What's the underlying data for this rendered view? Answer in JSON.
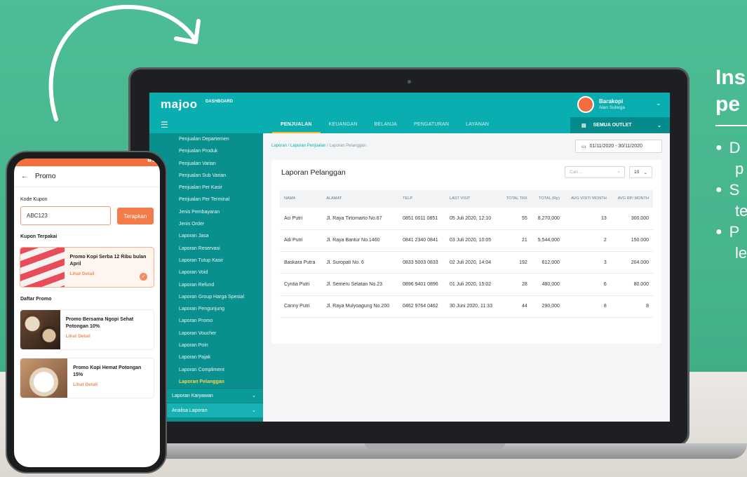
{
  "side": {
    "title_line1": "Ins",
    "title_line2": "pe",
    "bullets": [
      {
        "first": "D",
        "second": "p"
      },
      {
        "first": "S",
        "second": "te"
      },
      {
        "first": "P",
        "second": "le"
      }
    ]
  },
  "app": {
    "logo": "majoo",
    "logo_sub": "DASHBOARD",
    "user_name": "Barakopi",
    "user_sub": "Alan Suteqja"
  },
  "nav": {
    "tabs": [
      "PENJUALAN",
      "KEUANGAN",
      "BELANJA",
      "PENGATURAN",
      "LAYANAN"
    ],
    "active_tab": "PENJUALAN",
    "outlet": "SEMUA OUTLET"
  },
  "sidebar": {
    "items": [
      "Penjualan Departemen",
      "Penjualan Produk",
      "Penjualan Varian",
      "Penjualan Sub Varian",
      "Penjualan Per Kasir",
      "Penjualan Per Terminal",
      "Jenis Pembayaran",
      "Jenis Order",
      "Laporan Jasa",
      "Laporan Reservasi",
      "Laporan Tutup Kasir",
      "Laporan Void",
      "Laporan Refund",
      "Laporan Group Harga Spesial",
      "Laporan Pengunjung",
      "Laporan Promo",
      "Laporan Voucher",
      "Laporan Poin",
      "Laporan Pajak",
      "Laporan Compliment",
      "Laporan Pelanggan"
    ],
    "active_item": "Laporan Pelanggan",
    "section1": "Laporan Karyawan",
    "section2": "Analisa Laporan"
  },
  "breadcrumb": {
    "l1": "Laporan",
    "l2": "Laporan Penjualan",
    "l3": "Laporan Pelanggan"
  },
  "date_range": "01/11/2020  -  30/11/2020",
  "report": {
    "title": "Laporan Pelanggan",
    "search_placeholder": "Cari ...",
    "per_page": "10",
    "columns": [
      "NAMA",
      "ALAMAT",
      "TELP",
      "LAST VISIT",
      "TOTAL TRX",
      "TOTAL (Rp)",
      "AVG VISIT/ MONTH",
      "AVG RP/ MONTH"
    ],
    "rows": [
      [
        "Aci Putri",
        "Jl. Raya Tirtomarto No.67",
        "0851 0011 0851",
        "05 Juli 2020, 12:10",
        "55",
        "8,270,000",
        "13",
        "300.000"
      ],
      [
        "Adi Putri",
        "Jl. Raya Bantur No.1460",
        "0841 2340 0841",
        "03 Juli 2020, 10:05",
        "21",
        "5,544,000",
        "2",
        "150.000"
      ],
      [
        "Baskara Putra",
        "Jl. Suropati No. 6",
        "0833 5003 0833",
        "02 Juli 2020, 14:04",
        "192",
        "612,000",
        "3",
        "204.000"
      ],
      [
        "Cyntia Putri",
        "Jl. Semeru Selatan No.23",
        "0896 9401 0896",
        "01 Juli 2020, 15:02",
        "28",
        "480,000",
        "6",
        "80.000"
      ],
      [
        "Canny Putri",
        "Jl. Raya Mulyoagung No.200",
        "0462 9764 0462",
        "30 Juni 2020, 11:33",
        "44",
        "290,000",
        "8",
        "8"
      ]
    ]
  },
  "phone": {
    "title": "Promo",
    "coupon_label": "Kode Kupon",
    "coupon_value": "ABC123",
    "apply": "Terapkan",
    "used_label": "Kupon Terpakai",
    "promo_list_label": "Daftar Promo",
    "promos": [
      {
        "title": "Promo Kopi Serba 12 Ribu bulan April",
        "link": "Lihat Detail"
      },
      {
        "title": "Promo Bersama Ngopi Sehat Potongan 10%",
        "link": "Lihat Detail"
      },
      {
        "title": "Promo Kopi Hemat Potongan 15%",
        "link": "Lihat Detail"
      }
    ]
  },
  "colors": {
    "teal": "#0aaeb0",
    "orange": "#f37b4a",
    "bg": "#4dbd95"
  }
}
